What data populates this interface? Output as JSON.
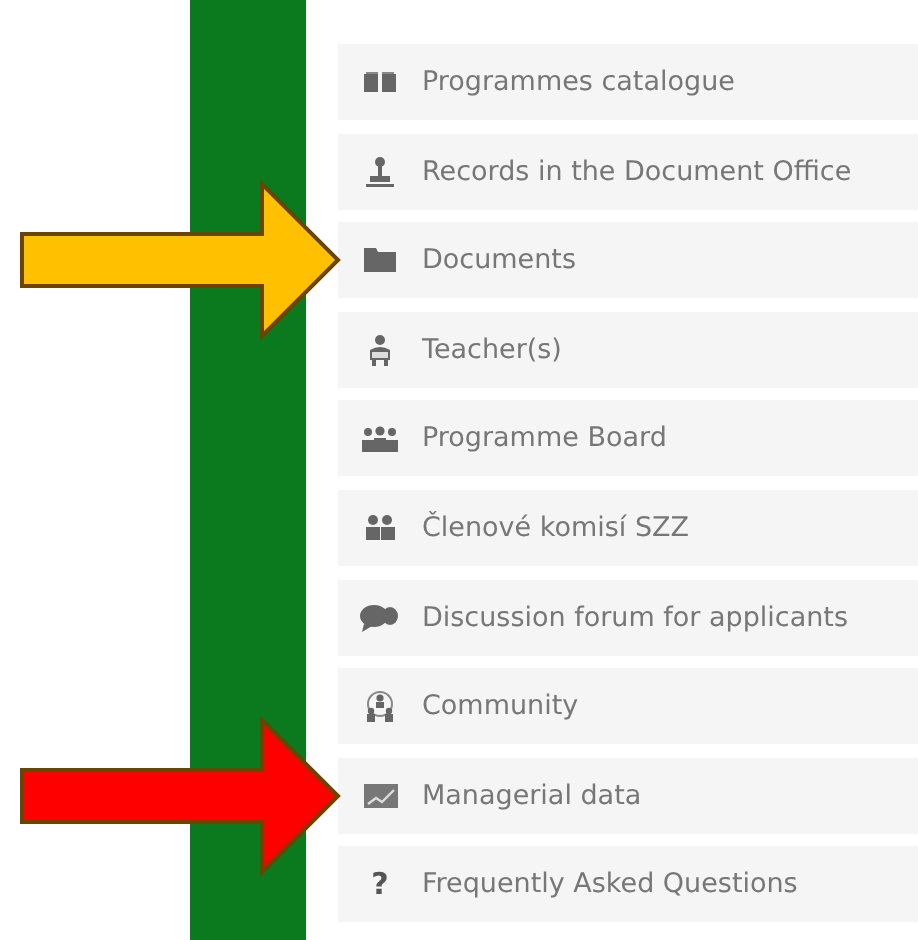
{
  "menu": [
    {
      "label": "Programmes catalogue"
    },
    {
      "label": "Records in the Document Office"
    },
    {
      "label": "Documents",
      "arrow": {
        "color": "#ffc000"
      }
    },
    {
      "label": "Teacher(s)"
    },
    {
      "label": "Programme Board"
    },
    {
      "label": "Členové komisí SZZ"
    },
    {
      "label": "Discussion forum for applicants"
    },
    {
      "label": "Community"
    },
    {
      "label": "Managerial data",
      "arrow": {
        "color": "#ff0000"
      }
    },
    {
      "label": "Frequently Asked Questions",
      "glyph": "?"
    }
  ]
}
